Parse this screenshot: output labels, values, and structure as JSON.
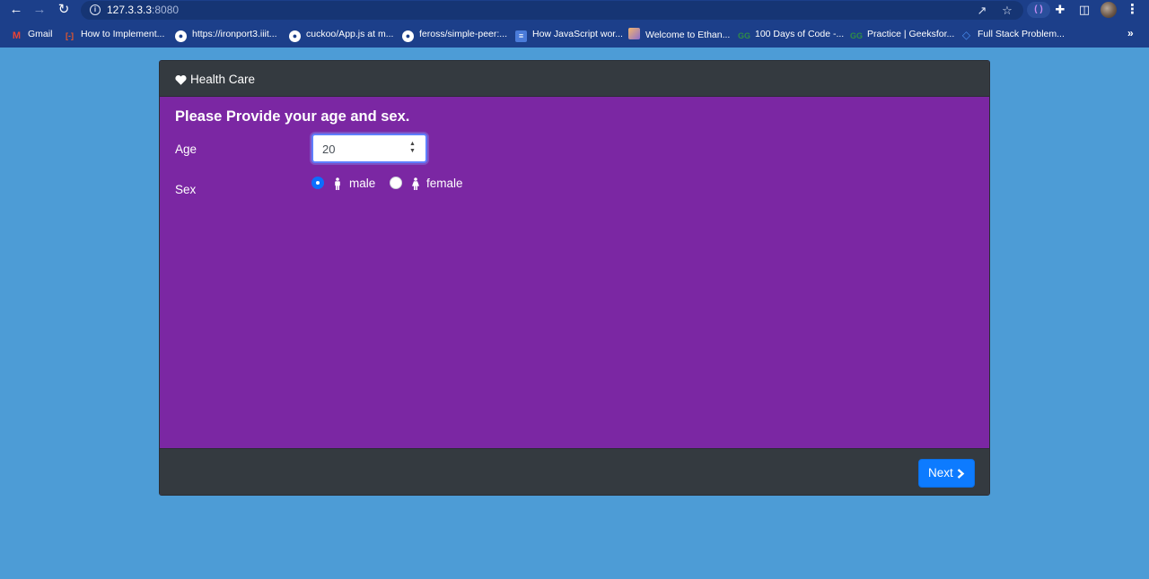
{
  "browser": {
    "url_host": "127.3.3.3",
    "url_port": ":8080",
    "bookmarks": [
      {
        "label": "Gmail",
        "icon": "gmail-icon"
      },
      {
        "label": "How to Implement...",
        "icon": "code-icon"
      },
      {
        "label": "https://ironport3.iiit...",
        "icon": "globe-icon"
      },
      {
        "label": "cuckoo/App.js at m...",
        "icon": "github-icon"
      },
      {
        "label": "feross/simple-peer:...",
        "icon": "github-icon"
      },
      {
        "label": "How JavaScript wor...",
        "icon": "document-icon"
      },
      {
        "label": "Welcome to Ethan...",
        "icon": "image-icon"
      },
      {
        "label": "100 Days of Code -...",
        "icon": "geeksforgeeks-icon"
      },
      {
        "label": "Practice | Geeksfor...",
        "icon": "geeksforgeeks-icon"
      },
      {
        "label": "Full Stack Problem...",
        "icon": "diamond-icon"
      }
    ],
    "more": "»"
  },
  "app": {
    "brand": "Health Care",
    "question": "Please Provide your age and sex.",
    "age_label": "Age",
    "age_value": "20",
    "sex_label": "Sex",
    "options": [
      {
        "label": "male",
        "checked": true
      },
      {
        "label": "female",
        "checked": false
      }
    ],
    "next_label": "Next"
  },
  "colors": {
    "page_bg": "#4d9cd6",
    "card_body": "#7b27a3",
    "card_bar": "#343a40",
    "accent": "#0d7bff",
    "browser_bar": "#1c3f8a"
  }
}
